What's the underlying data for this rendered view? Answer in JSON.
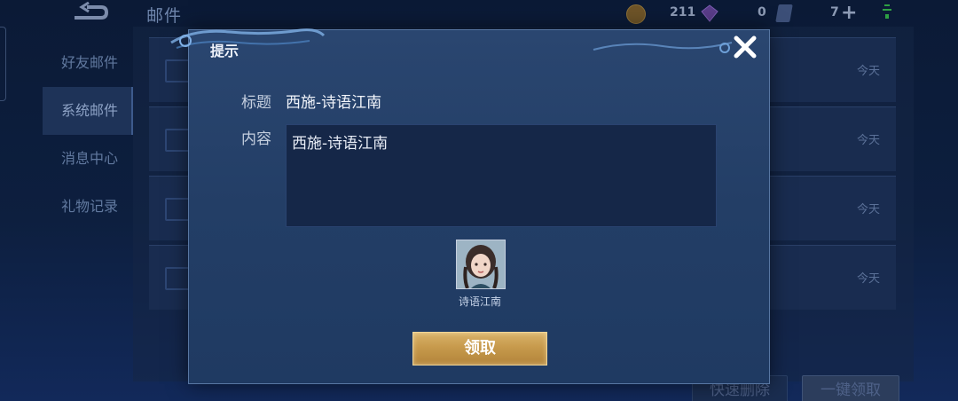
{
  "background": {
    "title": "邮件",
    "sidebar": [
      {
        "label": "好友邮件"
      },
      {
        "label": "系统邮件"
      },
      {
        "label": "消息中心"
      },
      {
        "label": "礼物记录"
      }
    ],
    "mail_rows": [
      {
        "date": "今天"
      },
      {
        "date": "今天"
      },
      {
        "date": "今天"
      },
      {
        "date": "今天"
      }
    ],
    "currency": {
      "coins": "211",
      "gems": "0",
      "tickets": "7"
    },
    "buttons": {
      "quick_delete": "快速删除",
      "collect_all": "一键领取"
    }
  },
  "dialog": {
    "title": "提示",
    "subject_label": "标题",
    "subject_value": "西施-诗语江南",
    "content_label": "内容",
    "content_value": "西施-诗语江南",
    "reward_name": "诗语江南",
    "claim_label": "领取"
  },
  "icons": {
    "back": "back-arrow-icon",
    "close": "close-icon",
    "coin": "coin-icon",
    "gem": "gem-icon",
    "ticket": "ticket-icon",
    "wifi": "wifi-icon"
  },
  "colors": {
    "dialog_bg": "#233e66",
    "claim_button": "#c79a4c",
    "close_x": "#ffffff"
  }
}
